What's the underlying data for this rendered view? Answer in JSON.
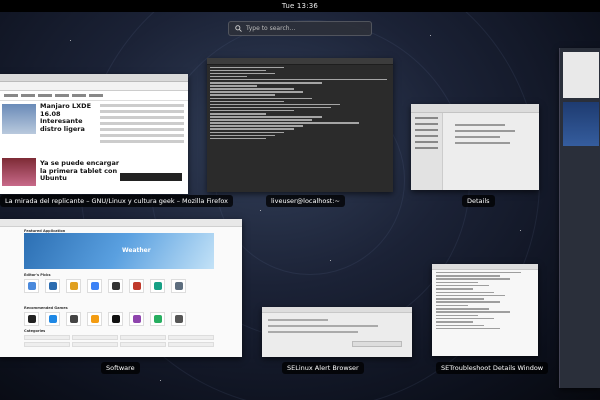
{
  "topbar": {
    "clock": "Tue 13:36"
  },
  "search": {
    "placeholder": "Type to search…"
  },
  "windows": {
    "firefox": {
      "label": "La mirada del replicante – GNU/Linux y cultura geek – Mozilla Firefox",
      "headline1": "Manjaro LXDE 16.08 Interesante distro ligera",
      "headline2": "Ya se puede encargar la primera tablet con Ubuntu"
    },
    "terminal": {
      "label": "liveuser@localhost:~"
    },
    "details": {
      "label": "Details"
    },
    "software": {
      "label": "Software",
      "featured": "Featured Application",
      "banner_title": "Weather",
      "editors_picks": "Editor's Picks",
      "recommended": "Recommended Games",
      "categories": "Categories"
    },
    "selinux": {
      "label": "SELinux Alert Browser"
    },
    "setroubleshoot": {
      "label": "SETroubleshoot Details Window"
    }
  },
  "icons": [
    "search-icon"
  ]
}
